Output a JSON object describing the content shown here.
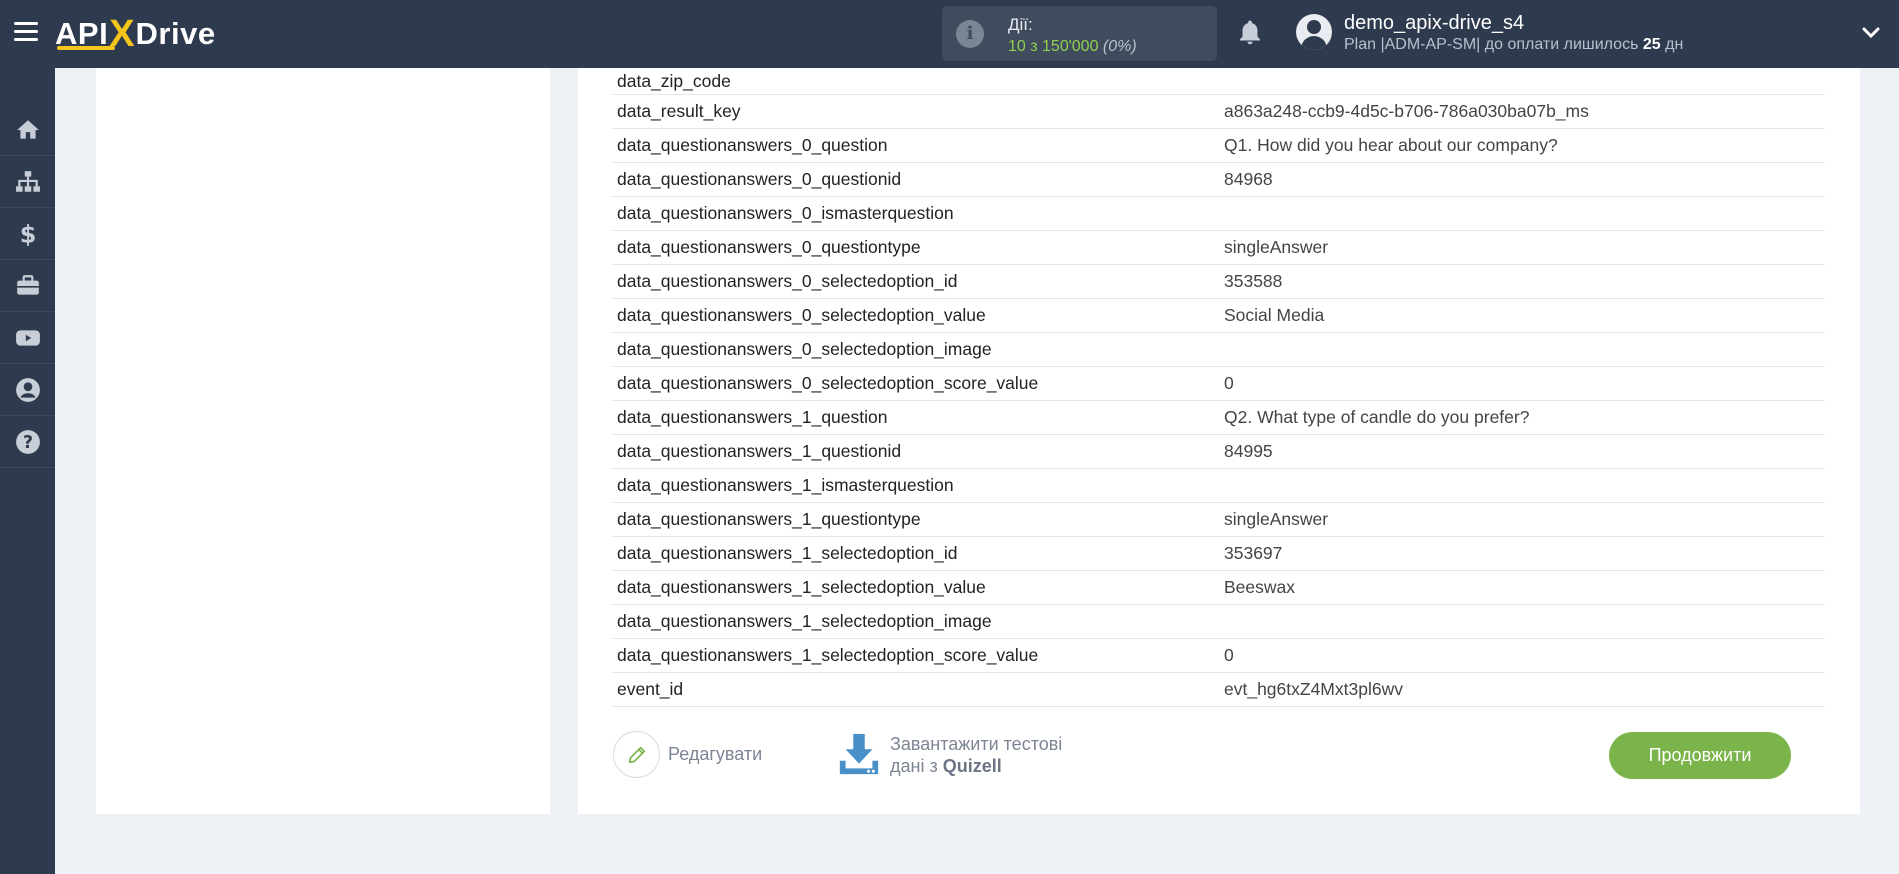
{
  "header": {
    "logo_api": "API",
    "logo_x": "X",
    "logo_drive": "Drive",
    "actions_label": "Дії:",
    "actions_value": "10 з 150'000",
    "actions_percent": "(0%)",
    "user_name": "demo_apix-drive_s4",
    "plan_prefix": "Plan |ADM-AP-SM| до оплати лишилось ",
    "plan_days": "25",
    "plan_suffix": " дн"
  },
  "sidebar": {
    "items": [
      {
        "icon": "home-icon"
      },
      {
        "icon": "sitemap-icon"
      },
      {
        "icon": "dollar-icon"
      },
      {
        "icon": "briefcase-icon"
      },
      {
        "icon": "youtube-icon"
      },
      {
        "icon": "user-circle-icon"
      },
      {
        "icon": "help-icon"
      }
    ]
  },
  "table": {
    "rows": [
      {
        "key": "data_zip_code",
        "value": ""
      },
      {
        "key": "data_result_key",
        "value": "a863a248-ccb9-4d5c-b706-786a030ba07b_ms"
      },
      {
        "key": "data_questionanswers_0_question",
        "value": "Q1. How did you hear about our company?"
      },
      {
        "key": "data_questionanswers_0_questionid",
        "value": "84968"
      },
      {
        "key": "data_questionanswers_0_ismasterquestion",
        "value": ""
      },
      {
        "key": "data_questionanswers_0_questiontype",
        "value": "singleAnswer"
      },
      {
        "key": "data_questionanswers_0_selectedoption_id",
        "value": "353588"
      },
      {
        "key": "data_questionanswers_0_selectedoption_value",
        "value": "Social Media"
      },
      {
        "key": "data_questionanswers_0_selectedoption_image",
        "value": ""
      },
      {
        "key": "data_questionanswers_0_selectedoption_score_value",
        "value": "0"
      },
      {
        "key": "data_questionanswers_1_question",
        "value": "Q2. What type of candle do you prefer?"
      },
      {
        "key": "data_questionanswers_1_questionid",
        "value": "84995"
      },
      {
        "key": "data_questionanswers_1_ismasterquestion",
        "value": ""
      },
      {
        "key": "data_questionanswers_1_questiontype",
        "value": "singleAnswer"
      },
      {
        "key": "data_questionanswers_1_selectedoption_id",
        "value": "353697"
      },
      {
        "key": "data_questionanswers_1_selectedoption_value",
        "value": "Beeswax"
      },
      {
        "key": "data_questionanswers_1_selectedoption_image",
        "value": ""
      },
      {
        "key": "data_questionanswers_1_selectedoption_score_value",
        "value": "0"
      },
      {
        "key": "event_id",
        "value": "evt_hg6txZ4Mxt3pl6wv"
      }
    ]
  },
  "footer": {
    "edit_label": "Редагувати",
    "load_line1": "Завантажити тестові",
    "load_line2_prefix": "дані з ",
    "load_source": "Quizell",
    "continue_label": "Продовжити"
  },
  "colors": {
    "topbar": "#2e3a4d",
    "accent_green": "#7ab44a",
    "logo_yellow": "#f5c51b",
    "download_blue": "#4a90c8"
  }
}
